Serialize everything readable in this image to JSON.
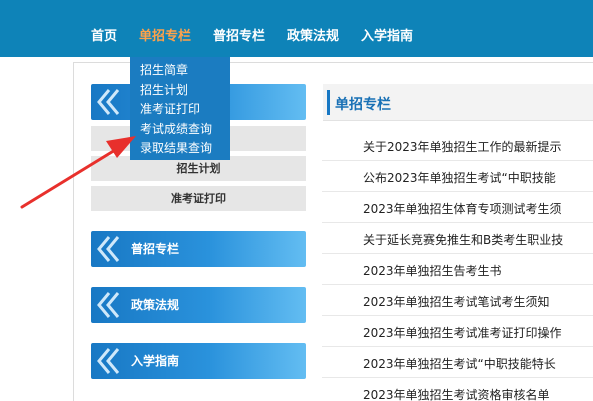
{
  "nav": {
    "items": [
      "首页",
      "单招专栏",
      "普招专栏",
      "政策法规",
      "入学指南"
    ],
    "active": "单招专栏"
  },
  "dropdown": {
    "items": [
      "招生简章",
      "招生计划",
      "准考证打印",
      "考试成绩查询",
      "录取结果查询"
    ]
  },
  "sidebar": {
    "sub_items": [
      "招生计划",
      "准考证打印"
    ],
    "sections": [
      "普招专栏",
      "政策法规",
      "入学指南"
    ]
  },
  "panel": {
    "title": "单招专栏",
    "news": [
      "关于2023年单独招生工作的最新提示",
      "公布2023年单独招生考试“中职技能",
      "2023年单独招生体育专项测试考生须",
      "关于延长竞赛免推生和B类考生职业技",
      "2023年单独招生告考生书",
      "2023年单独招生考试笔试考生须知",
      "2023年单独招生考试准考证打印操作",
      "2023年单独招生考试“中职技能特长",
      "2023年单独招生考试资格审核名单"
    ]
  },
  "colors": {
    "topbar": "#0e83b8",
    "active_nav": "#ffa24a",
    "dropdown": "#1b7cc1",
    "arrow": "#e8302c"
  }
}
